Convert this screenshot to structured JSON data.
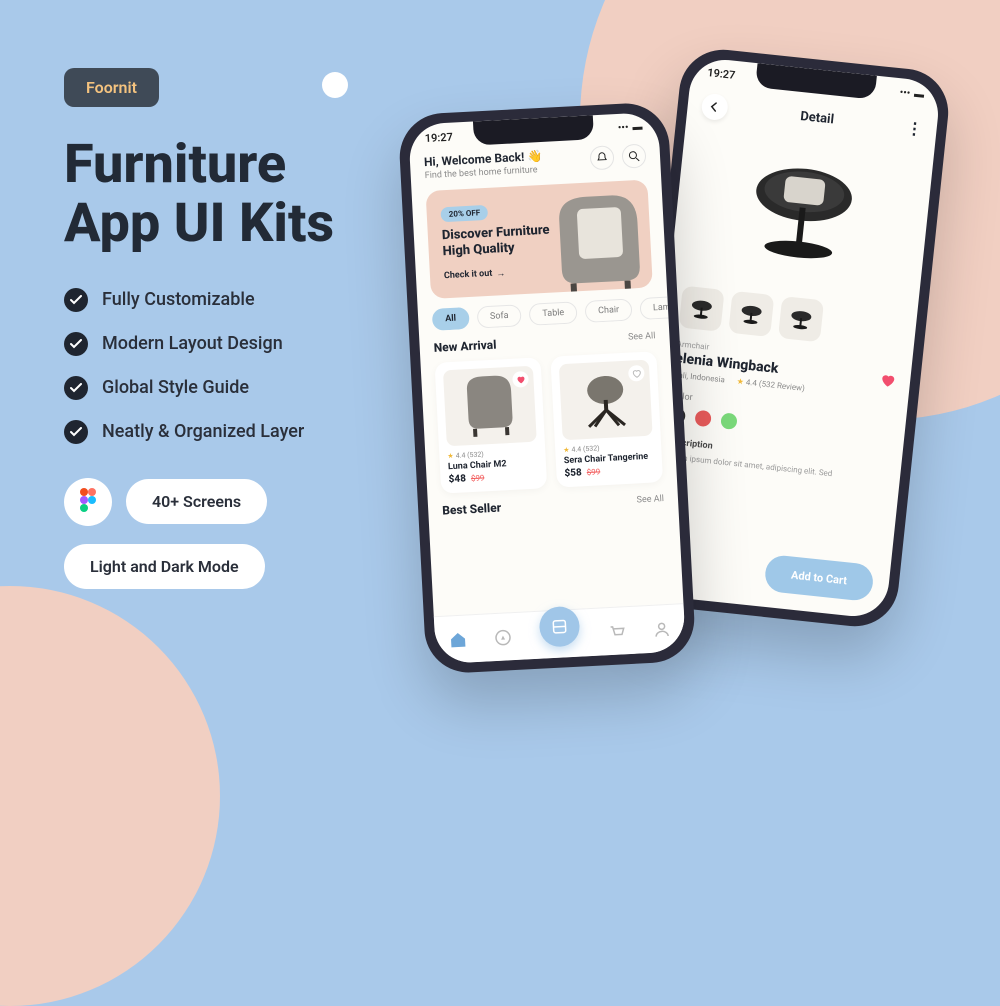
{
  "brand": "Foornit",
  "heading_l1": "Furniture",
  "heading_l2": "App UI Kits",
  "features": [
    "Fully Customizable",
    "Modern Layout Design",
    "Global Style Guide",
    "Neatly & Organized Layer"
  ],
  "pills": {
    "screens": "40+ Screens",
    "mode": "Light and Dark Mode"
  },
  "phone": {
    "time": "19:27"
  },
  "home": {
    "greeting": "Hi, Welcome Back! 👋",
    "subtitle": "Find the best home furniture",
    "promo_badge": "20% OFF",
    "promo_l1": "Discover Furniture",
    "promo_l2": "High Quality",
    "promo_cta": "Check it out",
    "chips": [
      "All",
      "Sofa",
      "Table",
      "Chair",
      "Lamp"
    ],
    "section_new": "New Arrival",
    "section_best": "Best Seller",
    "see_all": "See All",
    "rating_text": "4.4 (532)",
    "products": [
      {
        "name": "Luna Chair M2",
        "price": "$48",
        "old": "$99"
      },
      {
        "name": "Sera Chair Tangerine",
        "price": "$58",
        "old": "$99"
      }
    ]
  },
  "detail": {
    "title": "Detail",
    "category": "Armchair",
    "name": "elenia Wingback",
    "location": "Bali, Indonesia",
    "rating": "4.4 (532 Review)",
    "color_label": "Color",
    "colors": [
      "#2c2c2c",
      "#e85b5b",
      "#7ad97a"
    ],
    "desc_label": "Description",
    "desc": "Lorem ipsum dolor sit amet, adipiscing elit. Sed",
    "cart": "Add to Cart"
  }
}
